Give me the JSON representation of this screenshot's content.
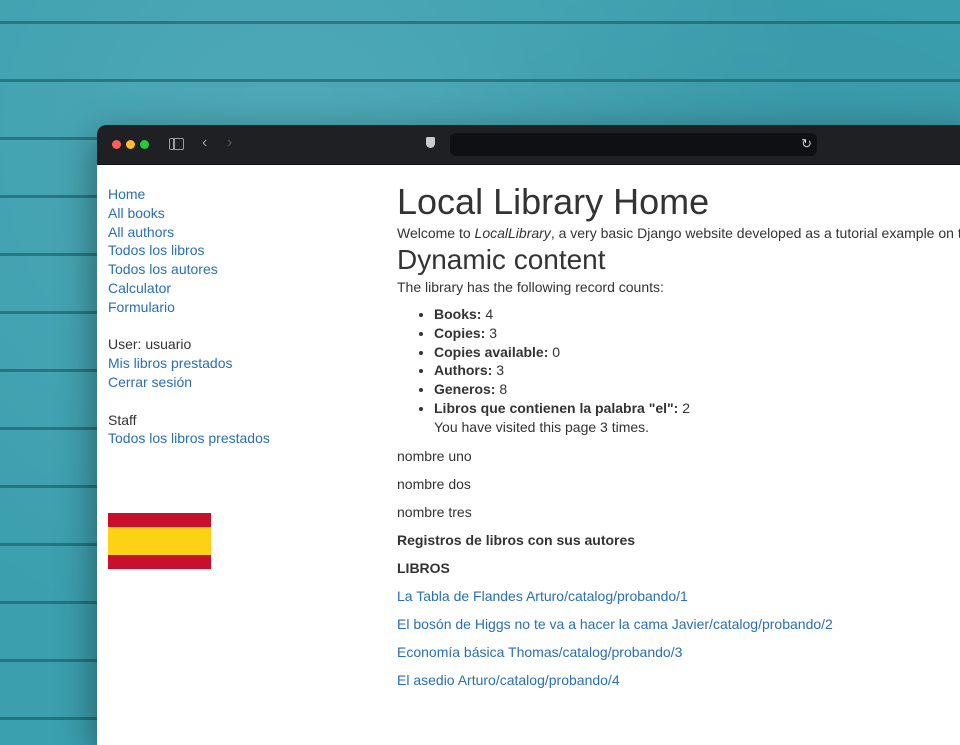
{
  "browser": {
    "toolbar_icons": [
      "sidebar-icon",
      "back-icon",
      "forward-icon",
      "shield-icon",
      "reload-icon"
    ],
    "address": ""
  },
  "sidebar": {
    "links": [
      {
        "label": "Home"
      },
      {
        "label": "All books"
      },
      {
        "label": "All authors"
      },
      {
        "label": "Todos los libros"
      },
      {
        "label": "Todos los autores"
      },
      {
        "label": "Calculator"
      },
      {
        "label": "Formulario"
      }
    ],
    "user_label": "User: usuario",
    "user_links": [
      {
        "label": "Mis libros prestados"
      },
      {
        "label": "Cerrar sesión"
      }
    ],
    "staff_label": "Staff",
    "staff_links": [
      {
        "label": "Todos los libros prestados"
      }
    ],
    "flag_colors": [
      "#c8102e",
      "#fcd116"
    ]
  },
  "main": {
    "title": "Local Library Home",
    "welcome_prefix": "Welcome to ",
    "welcome_em": "LocalLibrary",
    "welcome_suffix": ", a very basic Django website developed as a tutorial example on the Mo",
    "dynamic_heading": "Dynamic content",
    "counts_intro": "The library has the following record counts:",
    "counts": [
      {
        "label": "Books:",
        "value": "4"
      },
      {
        "label": "Copies:",
        "value": "3"
      },
      {
        "label": "Copies available:",
        "value": "0"
      },
      {
        "label": "Authors:",
        "value": "3"
      },
      {
        "label": "Generos:",
        "value": "8"
      },
      {
        "label": "Libros que contienen la palabra \"el\":",
        "value": "2"
      }
    ],
    "visited": "You have visited this page 3 times.",
    "names": [
      "nombre uno",
      "nombre dos",
      "nombre tres"
    ],
    "registros_heading": "Registros de libros con sus autores",
    "libros_heading": "LIBROS",
    "books": [
      "La Tabla de Flandes Arturo/catalog/probando/1",
      "El bosón de Higgs no te va a hacer la cama Javier/catalog/probando/2",
      "Economía básica Thomas/catalog/probando/3",
      "El asedio Arturo/catalog/probando/4"
    ],
    "link_color": "#2a6fb0"
  }
}
